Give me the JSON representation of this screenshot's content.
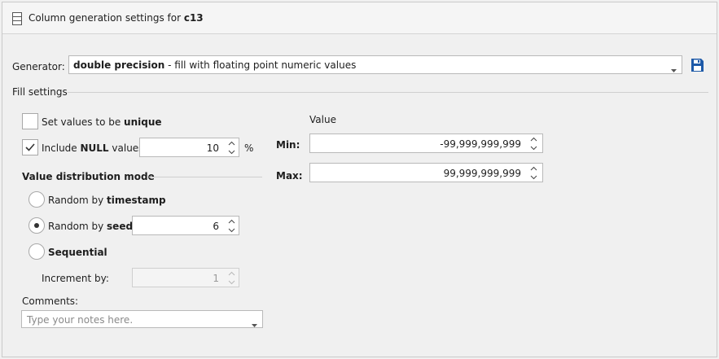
{
  "header": {
    "title_prefix": "Column generation settings for ",
    "column_name": "c13"
  },
  "generator": {
    "label": "Generator:",
    "value_bold": "double precision",
    "value_rest": " - fill with floating point numeric values"
  },
  "fill_settings": {
    "title": "Fill settings",
    "unique": {
      "label_prefix": "Set values to be ",
      "label_bold": "unique",
      "checked": false
    },
    "include_null": {
      "label_prefix": "Include ",
      "label_bold": "NULL",
      "label_suffix": " values",
      "checked": true,
      "value": "10",
      "unit": "%"
    },
    "distribution": {
      "title": "Value distribution mode",
      "random_timestamp": {
        "prefix": "Random by ",
        "bold": "timestamp",
        "selected": false
      },
      "random_seed": {
        "prefix": "Random by ",
        "bold": "seed",
        "selected": true,
        "value": "6"
      },
      "sequential": {
        "bold": "Sequential",
        "selected": false
      },
      "increment": {
        "label": "Increment by:",
        "value": "1"
      }
    },
    "comments": {
      "label": "Comments:",
      "placeholder": "Type your notes here."
    },
    "range": {
      "title": "Value",
      "min_label": "Min:",
      "min_value": "-99,999,999,999",
      "max_label": "Max:",
      "max_value": "99,999,999,999"
    }
  },
  "colors": {
    "save_icon": "#1e5aa8",
    "checkmark": "#333333"
  }
}
